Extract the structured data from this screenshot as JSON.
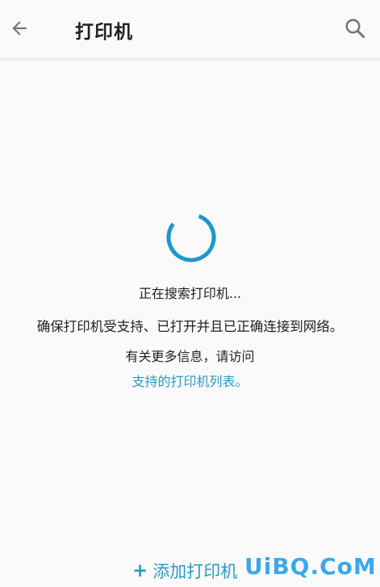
{
  "app_bar": {
    "title": "打印机",
    "back_icon": "arrow-left-icon",
    "search_icon": "search-icon"
  },
  "status": {
    "searching": "正在搜索打印机...",
    "ensure": "确保打印机受支持、已打开并且已正确连接到网络。",
    "more_info": "有关更多信息，请访问",
    "link": "支持的打印机列表。"
  },
  "actions": {
    "add_printer_icon": "+",
    "add_printer_label": "添加打印机"
  },
  "watermark": "UiBQ.CoM",
  "colors": {
    "accent": "#2a9bc4",
    "spinner": "#2196c8",
    "background": "#fafafa",
    "text": "#212121"
  }
}
